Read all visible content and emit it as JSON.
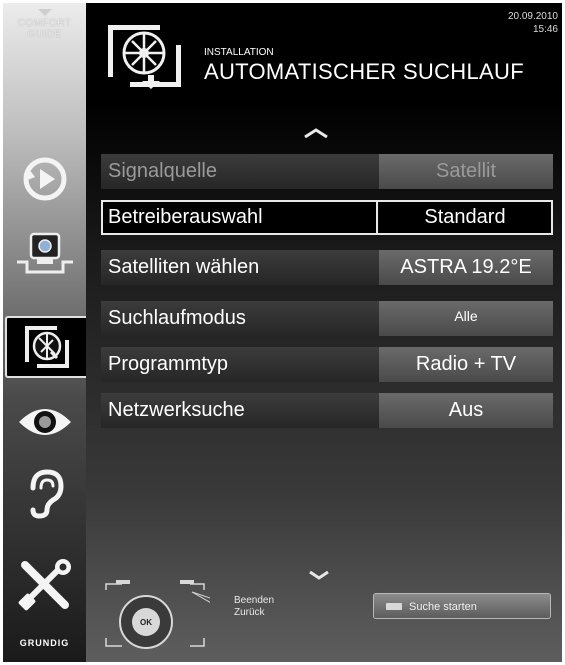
{
  "sidebar": {
    "comfort_guide": "COMFORT GUIDE",
    "brand": "GRUNDIG",
    "icons": [
      "playback-icon",
      "source-icon",
      "installation-icon",
      "picture-icon",
      "sound-icon",
      "settings-icon"
    ],
    "active": "installation-icon"
  },
  "header": {
    "date": "20.09.2010",
    "time": "15:46",
    "subtitle": "INSTALLATION",
    "title": "AUTOMATISCHER SUCHLAUF"
  },
  "menu": {
    "rows": [
      {
        "label": "Signalquelle",
        "value": "Satellit"
      },
      {
        "label": "Betreiberauswahl",
        "value": "Standard"
      },
      {
        "label": "Satelliten wählen",
        "value": "ASTRA 19.2°E"
      },
      {
        "label": "Suchlaufmodus",
        "value": "Alle"
      },
      {
        "label": "Programmtyp",
        "value": "Radio + TV"
      },
      {
        "label": "Netzwerksuche",
        "value": "Aus"
      }
    ],
    "selected_index": 1,
    "disabled_index": 0
  },
  "footer": {
    "remote_ok": "OK",
    "exit_label": "Beenden",
    "back_label": "Zurück",
    "search_button": "Suche starten"
  },
  "colors": {
    "background": "#000000",
    "value_cell": "#5a5a5a",
    "highlight_border": "#e8e8e8"
  }
}
